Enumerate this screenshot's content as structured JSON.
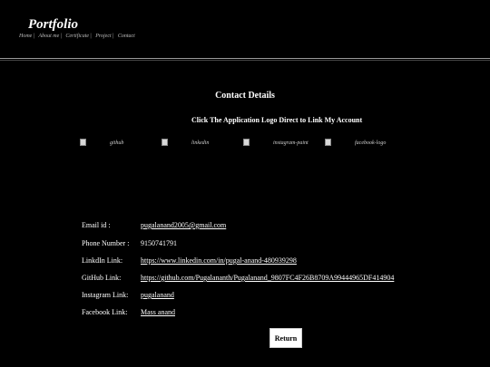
{
  "header": {
    "brand": "Portfolio",
    "nav": [
      {
        "label": "Home"
      },
      {
        "label": "About me"
      },
      {
        "label": "Certificate"
      },
      {
        "label": "Project"
      },
      {
        "label": "Contact"
      }
    ],
    "separator": "|"
  },
  "main": {
    "heading": "Contact Details",
    "subheading": "Click The Application Logo Direct to Link My Account",
    "logos": [
      {
        "alt": "github",
        "icon": "broken-image-icon"
      },
      {
        "alt": "linkedin",
        "icon": "broken-image-icon"
      },
      {
        "alt": "instagram-paint",
        "icon": "broken-image-icon"
      },
      {
        "alt": "facebook-logo",
        "icon": "broken-image-icon"
      }
    ],
    "contacts": [
      {
        "label": "Email id :",
        "value": "pugalanand2005@gmail.com",
        "link": true
      },
      {
        "label": "Phone Number :",
        "value": "9150741791",
        "link": false
      },
      {
        "label": "LinkdIn Link:",
        "value": "https://www.linkedin.com/in/pugal-anand-480939298",
        "link": true
      },
      {
        "label": "GitHub Link:",
        "value": "https://github.com/Pugalananth/Pugalanand_9807FC4F26B8709A99444965DF414904",
        "link": true
      },
      {
        "label": "Instagram Link:",
        "value": "pugalanand",
        "link": true
      },
      {
        "label": "Facebook Link:",
        "value": "Mass anand",
        "link": true
      }
    ],
    "return_label": "Return"
  },
  "colors": {
    "background": "#000000",
    "text": "#ffffff",
    "nav_text": "#bdbdbd",
    "button_bg": "#ffffff"
  }
}
